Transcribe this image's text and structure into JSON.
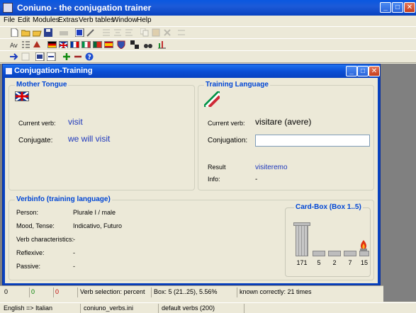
{
  "app": {
    "title": "Coniuno - the conjugation trainer",
    "controls": {
      "minimize": "_",
      "maximize": "□",
      "close": "✕"
    }
  },
  "menu": [
    "File",
    "Edit",
    "Modules",
    "Extras",
    "Verb tables",
    "Window",
    "Help"
  ],
  "child": {
    "title": "Conjugation-Training",
    "controls": {
      "minimize": "_",
      "maximize": "□",
      "close": "✕"
    }
  },
  "mother": {
    "title": "Mother Tongue",
    "current_verb_label": "Current verb:",
    "current_verb": "visit",
    "conjugate_label": "Conjugate:",
    "conjugate": "we will visit"
  },
  "training": {
    "title": "Training Language",
    "current_verb_label": "Current verb:",
    "current_verb": "visitare (avere)",
    "conjugation_label": "Conjugation:",
    "conjugation_value": "",
    "result_label": "Result",
    "result": "visiteremo",
    "info_label": "Info:",
    "info": "-"
  },
  "verbinfo": {
    "title": "Verbinfo (training language)",
    "rows": [
      {
        "label": "Person:",
        "value": "Plurale I / male"
      },
      {
        "label": "Mood, Tense:",
        "value": "Indicativo, Futuro"
      },
      {
        "label": "Verb characteristics:",
        "value": "-"
      },
      {
        "label": "Reflexive:",
        "value": "-"
      },
      {
        "label": "Passive:",
        "value": "-"
      }
    ]
  },
  "cardbox": {
    "title": "Card-Box (Box 1..5)",
    "counts": [
      "171",
      "5",
      "2",
      "7",
      "15"
    ]
  },
  "status": {
    "a": "0",
    "b": "0",
    "c": "0",
    "verb_selection": "Verb selection: percent",
    "box": "Box: 5 (21..25), 5.56%",
    "known": "known correctly: 21 times"
  },
  "bottom": {
    "language": "English => Italian",
    "file": "coniuno_verbs.ini",
    "verbs": "default verbs (200)"
  },
  "colors": {
    "accent": "#0046d5",
    "value": "#1f39bd",
    "green": "#008000",
    "red": "#c00000"
  }
}
